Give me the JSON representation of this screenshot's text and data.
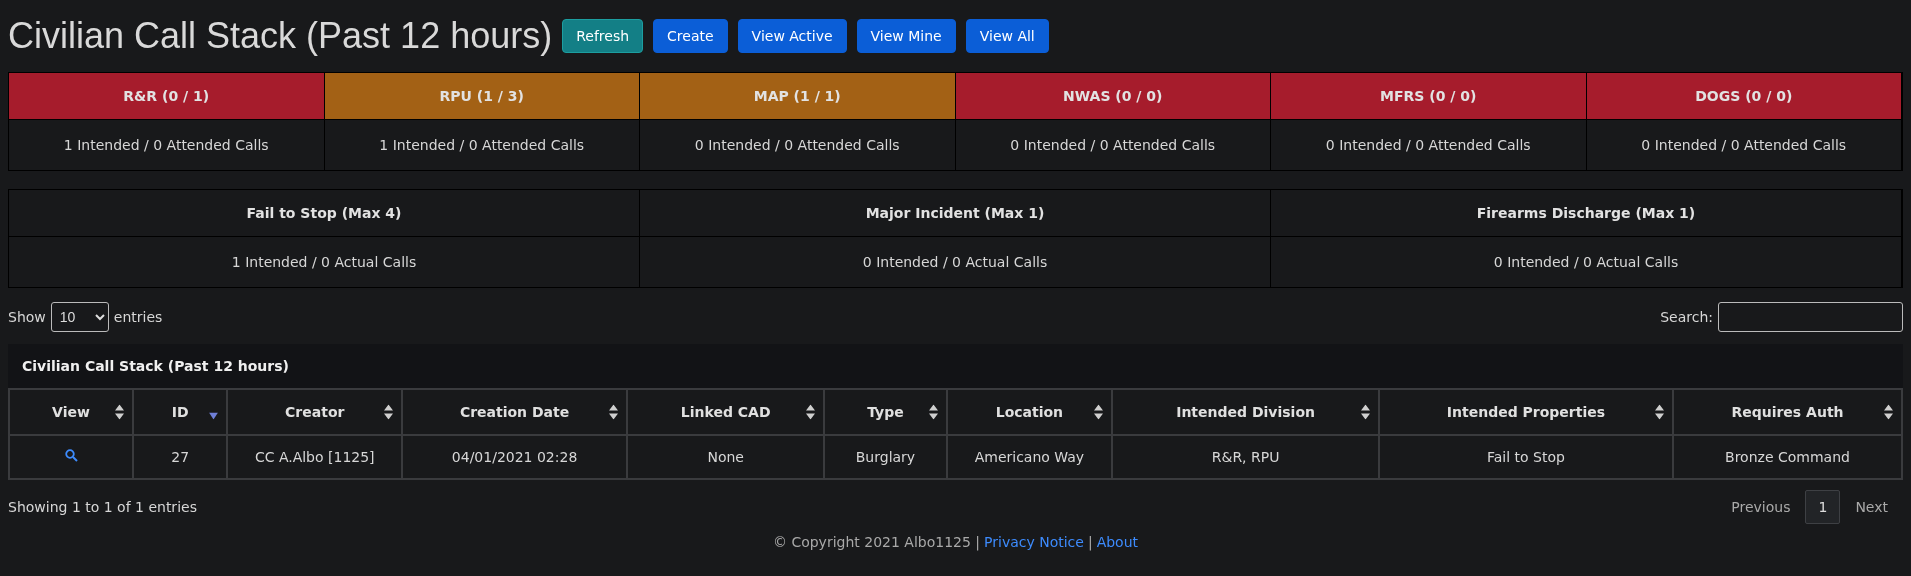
{
  "title": "Civilian Call Stack (Past 12 hours)",
  "buttons": [
    {
      "label": "Refresh",
      "kind": "info"
    },
    {
      "label": "Create",
      "kind": "primary"
    },
    {
      "label": "View Active",
      "kind": "primary"
    },
    {
      "label": "View Mine",
      "kind": "primary"
    },
    {
      "label": "View All",
      "kind": "primary"
    }
  ],
  "divisions": [
    {
      "name": "R&R (0 / 1)",
      "color": "#a61c2c",
      "summary": "1 Intended / 0 Attended Calls"
    },
    {
      "name": "RPU (1 / 3)",
      "color": "#a36115",
      "summary": "1 Intended / 0 Attended Calls"
    },
    {
      "name": "MAP (1 / 1)",
      "color": "#a36115",
      "summary": "0 Intended / 0 Attended Calls"
    },
    {
      "name": "NWAS (0 / 0)",
      "color": "#a61c2c",
      "summary": "0 Intended / 0 Attended Calls"
    },
    {
      "name": "MFRS (0 / 0)",
      "color": "#a61c2c",
      "summary": "0 Intended / 0 Attended Calls"
    },
    {
      "name": "DOGS (0 / 0)",
      "color": "#a61c2c",
      "summary": "0 Intended / 0 Attended Calls"
    }
  ],
  "properties": [
    {
      "name": "Fail to Stop (Max 4)",
      "summary": "1 Intended / 0 Actual Calls"
    },
    {
      "name": "Major Incident (Max 1)",
      "summary": "0 Intended / 0 Actual Calls"
    },
    {
      "name": "Firearms Discharge (Max 1)",
      "summary": "0 Intended / 0 Actual Calls"
    }
  ],
  "length_control": {
    "before": "Show",
    "value": "10",
    "after": "entries"
  },
  "search": {
    "label": "Search:"
  },
  "table": {
    "caption": "Civilian Call Stack (Past 12 hours)",
    "columns": [
      {
        "label": "View",
        "sorted": false
      },
      {
        "label": "ID",
        "sorted": true
      },
      {
        "label": "Creator",
        "sorted": false
      },
      {
        "label": "Creation Date",
        "sorted": false
      },
      {
        "label": "Linked CAD",
        "sorted": false
      },
      {
        "label": "Type",
        "sorted": false
      },
      {
        "label": "Location",
        "sorted": false
      },
      {
        "label": "Intended Division",
        "sorted": false
      },
      {
        "label": "Intended Properties",
        "sorted": false
      },
      {
        "label": "Requires Auth",
        "sorted": false
      }
    ],
    "rows": [
      {
        "cells": [
          "",
          "27",
          "CC A.Albo [1125]",
          "04/01/2021 02:28",
          "None",
          "Burglary",
          "Americano Way",
          "R&R, RPU",
          "Fail to Stop",
          "Bronze Command"
        ]
      }
    ]
  },
  "info": "Showing 1 to 1 of 1 entries",
  "pagination": [
    {
      "label": "Previous",
      "kind": "nav",
      "selected": false
    },
    {
      "label": "1",
      "kind": "page",
      "selected": true
    },
    {
      "label": "Next",
      "kind": "nav",
      "selected": false
    }
  ],
  "footer": {
    "copyright": "© Copyright 2021 Albo1125 |",
    "links": [
      {
        "label": "Privacy Notice"
      },
      {
        "label": "About"
      }
    ],
    "separator": "|"
  }
}
